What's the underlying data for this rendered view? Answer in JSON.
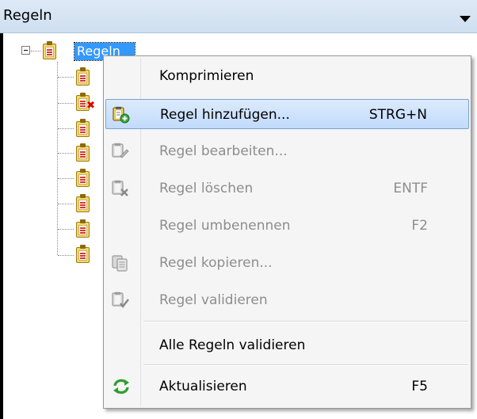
{
  "panel": {
    "title": "Regeln",
    "dropdown_icon": "triangle-down"
  },
  "tree": {
    "root_label": "Regeln",
    "root_icon": "clipboard-list-icon",
    "child_icons": [
      "clipboard-list-icon",
      "clipboard-list-error-icon",
      "clipboard-list-icon",
      "clipboard-list-icon",
      "clipboard-list-icon",
      "clipboard-list-icon",
      "clipboard-list-icon",
      "clipboard-list-icon"
    ]
  },
  "context_menu": {
    "items": [
      {
        "label": "Komprimieren",
        "shortcut": "",
        "enabled": true,
        "icon": ""
      },
      {
        "label": "Regel hinzufügen...",
        "shortcut": "STRG+N",
        "enabled": true,
        "icon": "add-rule-icon",
        "highlighted": true
      },
      {
        "label": "Regel bearbeiten...",
        "shortcut": "",
        "enabled": false,
        "icon": "edit-rule-icon"
      },
      {
        "label": "Regel löschen",
        "shortcut": "ENTF",
        "enabled": false,
        "icon": "delete-rule-icon"
      },
      {
        "label": "Regel umbenennen",
        "shortcut": "F2",
        "enabled": false,
        "icon": ""
      },
      {
        "label": "Regel kopieren...",
        "shortcut": "",
        "enabled": false,
        "icon": "copy-rule-icon"
      },
      {
        "label": "Regel validieren",
        "shortcut": "",
        "enabled": false,
        "icon": "validate-rule-icon"
      },
      {
        "label": "Alle Regeln validieren",
        "shortcut": "",
        "enabled": true,
        "icon": ""
      },
      {
        "label": "Aktualisieren",
        "shortcut": "F5",
        "enabled": true,
        "icon": "refresh-icon"
      }
    ]
  },
  "colors": {
    "selection": "#3399ff",
    "menu_hover": "#c1dbfc",
    "disabled_text": "#8d8d8d",
    "refresh_green": "#2e9e2e"
  }
}
